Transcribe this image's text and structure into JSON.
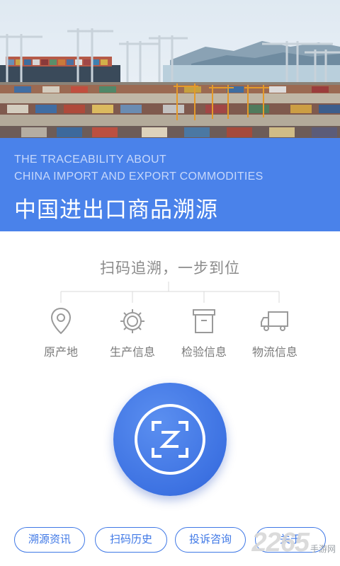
{
  "banner": {
    "en_line1": "THE TRACEABILITY ABOUT",
    "en_line2": "CHINA IMPORT AND EXPORT COMMODITIES",
    "title": "中国进出口商品溯源"
  },
  "slogan": "扫码追溯，一步到位",
  "features": [
    {
      "label": "原产地",
      "icon": "location-pin-icon"
    },
    {
      "label": "生产信息",
      "icon": "gear-icon"
    },
    {
      "label": "检验信息",
      "icon": "archive-box-icon"
    },
    {
      "label": "物流信息",
      "icon": "truck-icon"
    }
  ],
  "scan_button": {
    "icon": "scan-z-icon"
  },
  "bottom_nav": [
    {
      "label": "溯源资讯"
    },
    {
      "label": "扫码历史"
    },
    {
      "label": "投诉咨询"
    },
    {
      "label": "关于"
    }
  ],
  "watermark": {
    "number": "2265",
    "site": "手游网"
  },
  "colors": {
    "brand_blue": "#4a82ea",
    "button_blue": "#3f78e6",
    "gray_text": "#8b8b8b"
  }
}
